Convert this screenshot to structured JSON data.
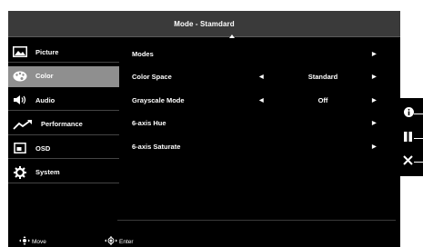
{
  "header": {
    "title": "Mode - Stamdard"
  },
  "sidebar": {
    "items": [
      {
        "label": "Picture",
        "icon": "picture-icon",
        "active": false
      },
      {
        "label": "Color",
        "icon": "palette-icon",
        "active": true
      },
      {
        "label": "Audio",
        "icon": "speaker-icon",
        "active": false
      },
      {
        "label": "Performance",
        "icon": "trend-icon",
        "active": false
      },
      {
        "label": "OSD",
        "icon": "osd-icon",
        "active": false
      },
      {
        "label": "System",
        "icon": "gear-icon",
        "active": false
      }
    ]
  },
  "main": {
    "rows": [
      {
        "label": "Modes",
        "value": ""
      },
      {
        "label": "Color Space",
        "value": "Standard"
      },
      {
        "label": "Grayscale Mode",
        "value": "Off"
      },
      {
        "label": "6-axis Hue",
        "value": ""
      },
      {
        "label": "6-axis Saturate",
        "value": ""
      }
    ]
  },
  "footer": {
    "move_label": "Move",
    "enter_label": "Enter"
  },
  "side_buttons": [
    {
      "icon": "info-icon"
    },
    {
      "icon": "pause-icon"
    },
    {
      "icon": "close-icon"
    }
  ],
  "colors": {
    "background": "#000000",
    "active_item": "#8f8f8f",
    "title_bar": "#3a3a3a",
    "text": "#ffffff"
  }
}
